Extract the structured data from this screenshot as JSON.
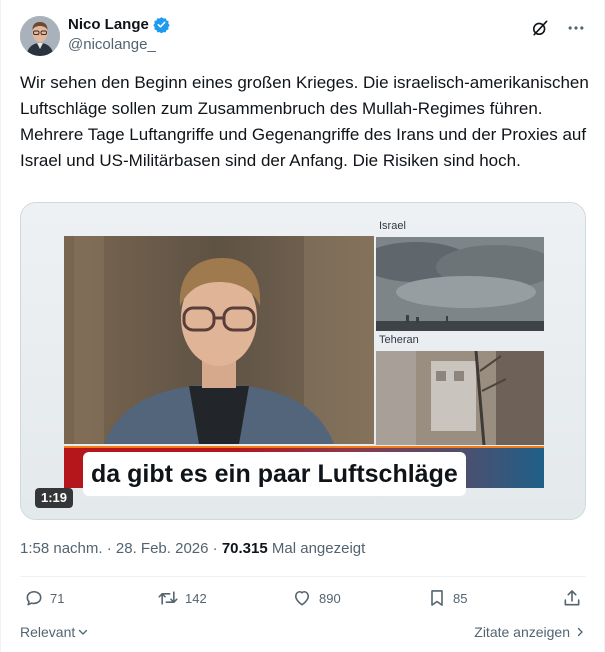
{
  "author": {
    "display_name": "Nico Lange",
    "handle": "@nicolange_",
    "verified": true,
    "avatar_icon": "profile-photo"
  },
  "header_icons": [
    "grok-icon",
    "more-icon"
  ],
  "tweet": {
    "text": "Wir sehen den Beginn eines großen Krieges. Die israelisch-amerikanischen Luftschläge sollen zum Zusammenbruch des Mullah-Regimes führen. Mehrere Tage Luftangriffe und Gegenangriffe des Irans und der Proxies auf Israel und US-Militärbasen sind der Anfang. Die Risiken sind hoch."
  },
  "media": {
    "label_israel": "Israel",
    "label_teheran": "Teheran",
    "subtitle": "da gibt es ein paar Luftschläge",
    "duration": "1:19"
  },
  "meta": {
    "time": "1:58 nachm.",
    "separator": " · ",
    "date": "28. Feb. 2026",
    "views_count": "70.315",
    "views_label": "Mal angezeigt"
  },
  "actions": {
    "replies": "71",
    "reposts": "142",
    "likes": "890",
    "bookmarks": "85"
  },
  "footer": {
    "relevant_label": "Relevant",
    "quotes_label": "Zitate anzeigen"
  },
  "colors": {
    "accent": "#1d9bf0",
    "text": "#0f1419",
    "secondary": "#536471",
    "border": "#cfd9de"
  }
}
